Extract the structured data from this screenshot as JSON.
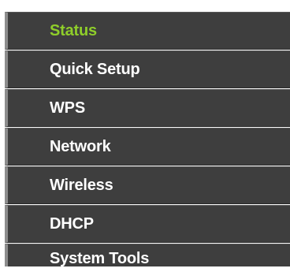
{
  "colors": {
    "menu_bg": "#3e3e3e",
    "text": "#ffffff",
    "active_text": "#8fce2a"
  },
  "menu": {
    "items": [
      {
        "label": "Status",
        "active": true
      },
      {
        "label": "Quick Setup",
        "active": false
      },
      {
        "label": "WPS",
        "active": false
      },
      {
        "label": "Network",
        "active": false
      },
      {
        "label": "Wireless",
        "active": false
      },
      {
        "label": "DHCP",
        "active": false
      },
      {
        "label": "System Tools",
        "active": false
      }
    ]
  }
}
